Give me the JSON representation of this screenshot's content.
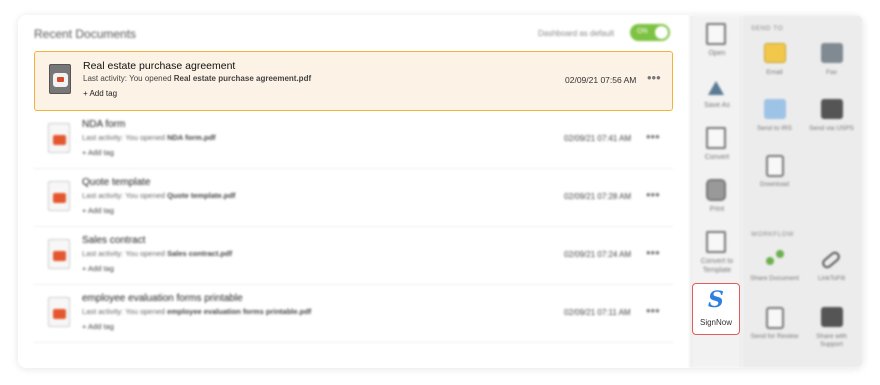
{
  "main": {
    "title": "Recent Documents",
    "dashboard_toggle_label": "Dashboard as default",
    "toggle_state": "ON"
  },
  "documents": [
    {
      "name": "Real estate purchase agreement",
      "activity_prefix": "Last activity: You opened ",
      "file": "Real estate purchase agreement.pdf",
      "add_tag": "+ Add tag",
      "date": "02/09/21 07:56 AM",
      "more": "•••"
    },
    {
      "name": "NDA form",
      "activity_prefix": "Last activity: You opened ",
      "file": "NDA form.pdf",
      "add_tag": "+ Add tag",
      "date": "02/09/21 07:41 AM",
      "more": "•••"
    },
    {
      "name": "Quote template",
      "activity_prefix": "Last activity: You opened ",
      "file": "Quote template.pdf",
      "add_tag": "+ Add tag",
      "date": "02/09/21 07:28 AM",
      "more": "•••"
    },
    {
      "name": "Sales contract",
      "activity_prefix": "Last activity: You opened ",
      "file": "Sales contract.pdf",
      "add_tag": "+ Add tag",
      "date": "02/09/21 07:24 AM",
      "more": "•••"
    },
    {
      "name": "employee evaluation forms printable",
      "activity_prefix": "Last activity: You opened ",
      "file": "employee evaluation forms printable.pdf",
      "add_tag": "+ Add tag",
      "date": "02/09/21 07:11 AM",
      "more": "•••"
    }
  ],
  "actions": [
    {
      "label": "Open",
      "icon": "open-icon"
    },
    {
      "label": "Save As",
      "icon": "save-as-icon"
    },
    {
      "label": "Convert",
      "icon": "convert-icon"
    },
    {
      "label": "Print",
      "icon": "print-icon"
    },
    {
      "label": "Convert to Template",
      "icon": "convert-template-icon"
    }
  ],
  "signnow": {
    "label": "SignNow",
    "glyph": "S",
    "icon": "signnow-icon",
    "border_color": "#e15b5b",
    "brand_color": "#2f7fe0"
  },
  "send": {
    "section_title": "SEND TO",
    "items": [
      {
        "label": "Email",
        "icon": "email-icon"
      },
      {
        "label": "Fax",
        "icon": "fax-icon"
      },
      {
        "label": "Send to IRS",
        "icon": "irs-icon"
      },
      {
        "label": "Send via USPS",
        "icon": "usps-icon"
      },
      {
        "label": "Download",
        "icon": "download-icon"
      }
    ]
  },
  "workflow": {
    "section_title": "WORKFLOW",
    "items": [
      {
        "label": "Share Document",
        "icon": "share-icon"
      },
      {
        "label": "LinkToFill",
        "icon": "link-icon"
      },
      {
        "label": "Send for Review",
        "icon": "review-icon"
      },
      {
        "label": "Share with Support",
        "icon": "support-icon"
      }
    ]
  },
  "colors": {
    "highlight_border": "#f0b43a",
    "highlight_bg": "#fdf2e6",
    "toggle_on": "#7dc242"
  }
}
